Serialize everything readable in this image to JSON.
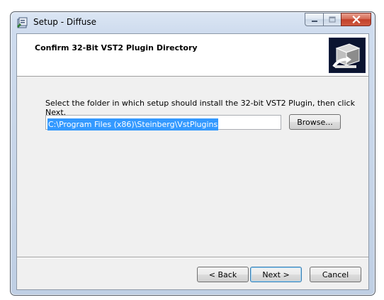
{
  "window": {
    "title": "Setup - Diffuse"
  },
  "header": {
    "title": "Confirm 32-Bit VST2 Plugin Directory"
  },
  "main": {
    "instruction": "Select the folder in which setup should install the 32-bit VST2 Plugin, then click Next.",
    "directory_value": "C:\\Program Files (x86)\\Steinberg\\VstPlugins",
    "browse_label": "Browse..."
  },
  "footer": {
    "back_label": "< Back",
    "next_label": "Next >",
    "cancel_label": "Cancel"
  },
  "colors": {
    "selection": "#3399ff",
    "close_button": "#c2402a",
    "logo_background": "#0b1430"
  }
}
